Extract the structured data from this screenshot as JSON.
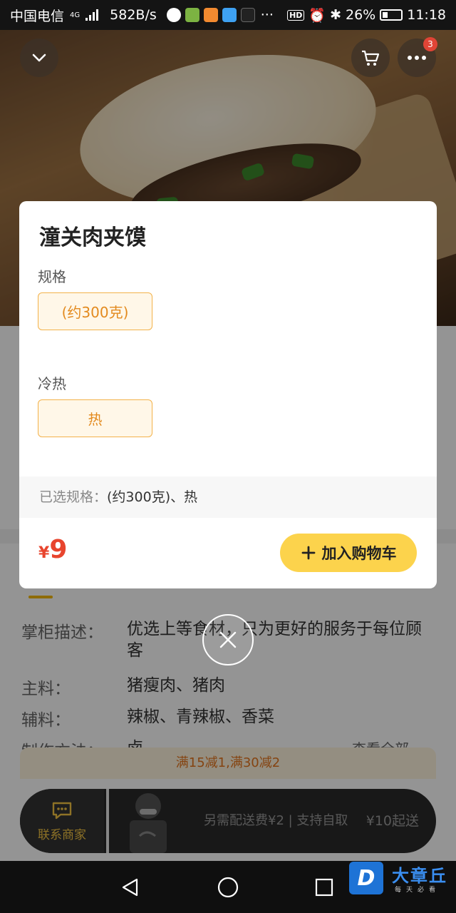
{
  "status_bar": {
    "carrier": "中国电信",
    "network": "4G",
    "speed": "582B/s",
    "more": "···",
    "hd": "HD",
    "battery": "26%",
    "time": "11:18"
  },
  "header": {
    "cart_badge": "3"
  },
  "dialog": {
    "title": "潼关肉夹馍",
    "spec_label": "规格",
    "spec_option": "(约300克)",
    "temp_label": "冷热",
    "temp_option": "热",
    "selected_label": "已选规格：",
    "selected_value": "(约300克)、热",
    "price_currency": "¥",
    "price_value": "9",
    "add_button": "加入购物车"
  },
  "details": {
    "rows": [
      {
        "key": "掌柜描述：",
        "value": "优选上等食材，只为更好的服务于每位顾客"
      },
      {
        "key": "主料：",
        "value": "猪瘦肉、猪肉"
      },
      {
        "key": "辅料：",
        "value": "辣椒、青辣椒、香菜"
      },
      {
        "key": "制作方法：",
        "value": "卤"
      }
    ],
    "view_all": "查看全部"
  },
  "promo": "满15减1,满30减2",
  "bottom_bar": {
    "contact": "联系商家",
    "delivery": "另需配送费¥2 | 支持自取",
    "min_order": "¥10起送"
  },
  "watermark": {
    "logo_letter": "D",
    "name": "大章丘",
    "sub": "每天必看"
  },
  "colors": {
    "accent_yellow": "#fcd34c",
    "price_red": "#e8452e",
    "option_orange": "#e38a1e"
  }
}
